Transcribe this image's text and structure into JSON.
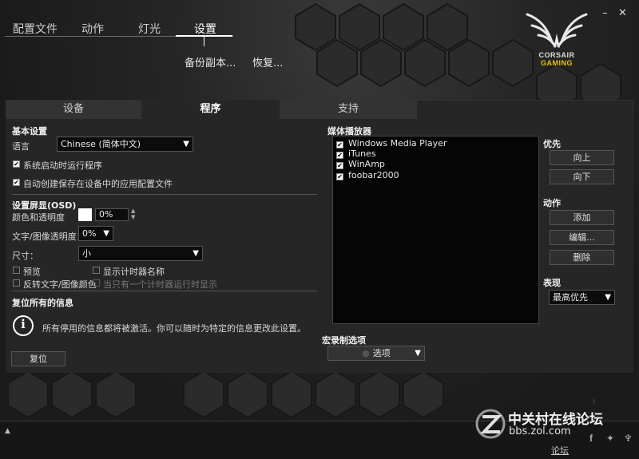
{
  "window": {
    "minimize": "–",
    "close": "✕"
  },
  "topnav": {
    "items": [
      "配置文件",
      "动作",
      "灯光",
      "设置"
    ],
    "active_index": 3
  },
  "subnav": {
    "backup": "备份副本...",
    "restore": "恢复..."
  },
  "logo": {
    "line1": "CORSAIR",
    "line2": "GAMING"
  },
  "tabs": [
    "设备",
    "程序",
    "支持"
  ],
  "active_tab": 1,
  "basic": {
    "title": "基本设置",
    "language_label": "语言",
    "language_value": "Chinese (简体中文)",
    "startup_label": "系统启动时运行程序",
    "startup_checked": true,
    "autocreate_label": "自动创建保存在设备中的应用配置文件",
    "autocreate_checked": true
  },
  "osd": {
    "title": "设置屏显(OSD)",
    "color_label": "颜色和透明度",
    "color_value": "0%",
    "text_opacity_label": "文字/图像透明度：",
    "text_opacity_value": "0%",
    "size_label": "尺寸：",
    "size_value": "小",
    "preview_label": "预览",
    "show_timer_name_label": "显示计时器名称",
    "invert_label": "反转文字/图像颜色",
    "only_one_timer_label": "当只有一个计时器运行时显示"
  },
  "reset": {
    "title": "复位所有的信息",
    "info": "所有停用的信息都将被激活。你可以随时为特定的信息更改此设置。",
    "button": "复位"
  },
  "media": {
    "title": "媒体播放器",
    "players": [
      "Windows Media Player",
      "iTunes",
      "WinAmp",
      "foobar2000"
    ],
    "priority_label": "优先",
    "up": "向上",
    "down": "向下",
    "action_label": "动作",
    "add": "添加",
    "edit": "编辑...",
    "delete": "删除",
    "performance_label": "表现",
    "performance_value": "最高优先"
  },
  "macro": {
    "title": "宏录制选项",
    "options_button": "选项"
  },
  "footer": {
    "watermark_title": "中关村在线论坛",
    "watermark_url": "bbs.zol.com",
    "forum_link": "论坛"
  },
  "colors": {
    "accent_yellow": "#e8c200",
    "panel_bg": "#262626",
    "list_bg": "#050505"
  }
}
